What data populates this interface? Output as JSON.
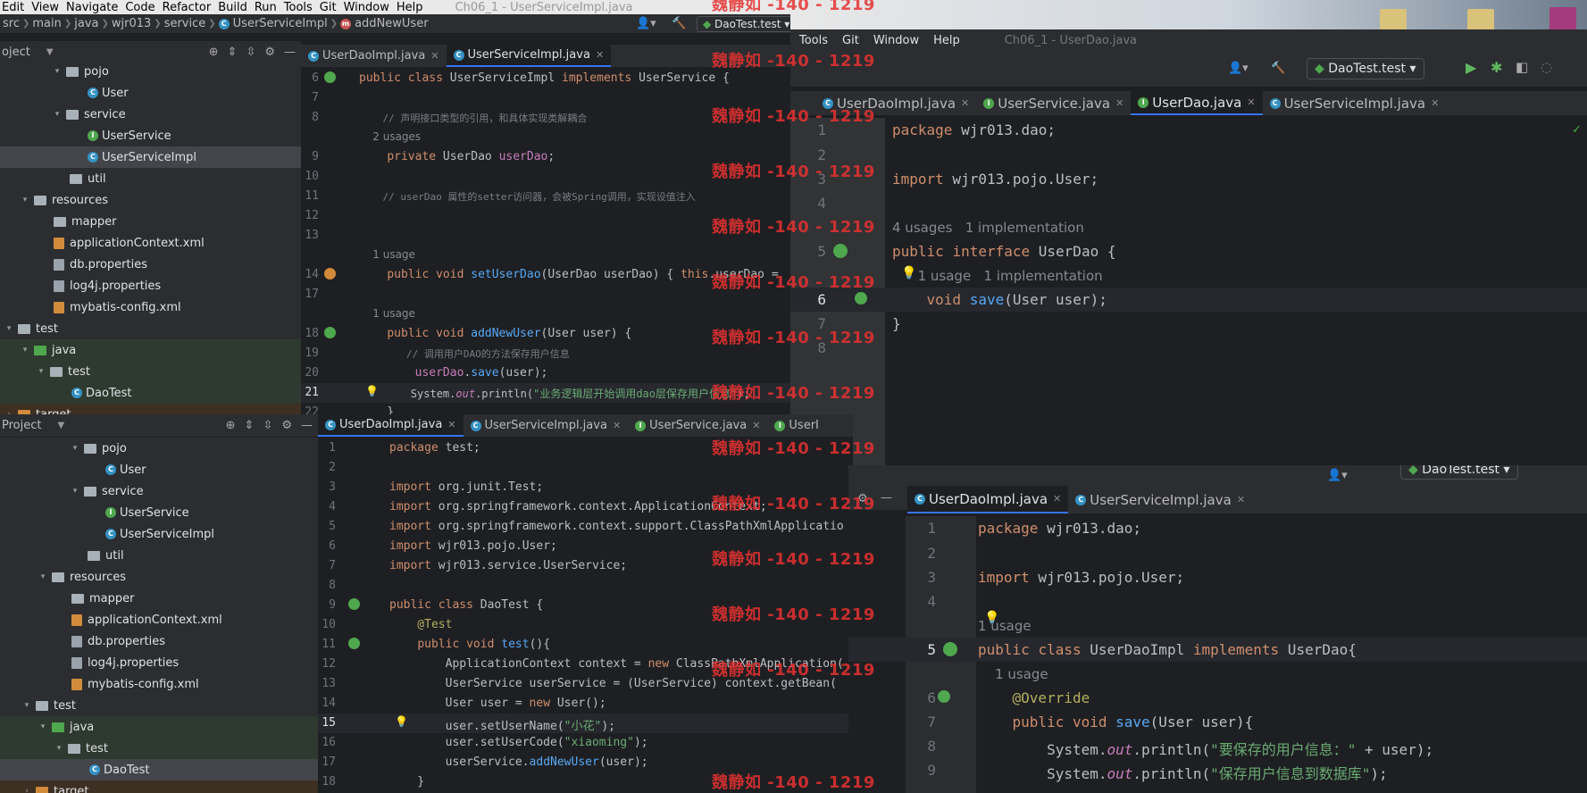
{
  "menu": [
    "Edit",
    "View",
    "Navigate",
    "Code",
    "Refactor",
    "Build",
    "Run",
    "Tools",
    "Git",
    "Window",
    "Help"
  ],
  "window_title_1": "Ch06_1 - UserServiceImpl.java",
  "breadcrumb": [
    "src",
    "main",
    "java",
    "wjr013",
    "service",
    "UserServiceImpl",
    "addNewUser"
  ],
  "run_config": "DaoTest.test",
  "topleft": {
    "tabs": [
      "UserDaoImpl.java",
      "UserServiceImpl.java"
    ],
    "project_label": "oject",
    "tree": [
      {
        "label": "pojo"
      },
      {
        "label": "User"
      },
      {
        "label": "service"
      },
      {
        "label": "UserService"
      },
      {
        "label": "UserServiceImpl"
      },
      {
        "label": "util"
      },
      {
        "label": "resources"
      },
      {
        "label": "mapper"
      },
      {
        "label": "applicationContext.xml"
      },
      {
        "label": "db.properties"
      },
      {
        "label": "log4j.properties"
      },
      {
        "label": "mybatis-config.xml"
      },
      {
        "label": "test"
      },
      {
        "label": "java"
      },
      {
        "label": "test"
      },
      {
        "label": "DaoTest"
      },
      {
        "label": "target"
      }
    ],
    "lines": [
      {
        "n": "6",
        "code": "public class UserServiceImpl implements UserService {"
      },
      {
        "n": "7",
        "code": ""
      },
      {
        "n": "8",
        "code": "    // 声明接口类型的引用，和具体实现类解耦合"
      },
      {
        "n": "",
        "code": "    2 usages"
      },
      {
        "n": "9",
        "code": "    private UserDao userDao;"
      },
      {
        "n": "10",
        "code": ""
      },
      {
        "n": "11",
        "code": "    // userDao 属性的setter访问器，会被Spring调用，实现设值注入"
      },
      {
        "n": "12",
        "code": ""
      },
      {
        "n": "13",
        "code": ""
      },
      {
        "n": "",
        "code": "    1 usage"
      },
      {
        "n": "14",
        "code": "    public void setUserDao(UserDao userDao) { this.userDao = "
      },
      {
        "n": "17",
        "code": ""
      },
      {
        "n": "",
        "code": "    1 usage"
      },
      {
        "n": "18",
        "code": "    public void addNewUser(User user) {"
      },
      {
        "n": "19",
        "code": "        // 调用用户DAO的方法保存用户信息"
      },
      {
        "n": "20",
        "code": "        userDao.save(user);"
      },
      {
        "n": "21",
        "code": "        System.out.println(\"业务逻辑层开始调用dao层保存用户信息\");"
      },
      {
        "n": "22",
        "code": "    }"
      }
    ]
  },
  "topright": {
    "menu": [
      "Tools",
      "Git",
      "Window",
      "Help"
    ],
    "title": "Ch06_1 - UserDao.java",
    "tabs": [
      "UserDaoImpl.java",
      "UserService.java",
      "UserDao.java",
      "UserServiceImpl.java"
    ],
    "lines": [
      {
        "n": "1",
        "code": "package wjr013.dao;"
      },
      {
        "n": "2",
        "code": ""
      },
      {
        "n": "3",
        "code": "import wjr013.pojo.User;"
      },
      {
        "n": "4",
        "code": ""
      },
      {
        "n": "",
        "code": "4 usages   1 implementation"
      },
      {
        "n": "5",
        "code": "public interface UserDao {"
      },
      {
        "n": "",
        "code": "      1 usage   1 implementation"
      },
      {
        "n": "6",
        "code": "    void save(User user);"
      },
      {
        "n": "7",
        "code": "}"
      },
      {
        "n": "8",
        "code": ""
      }
    ]
  },
  "bottomleft": {
    "project_label": "Project",
    "tabs": [
      "UserDaoImpl.java",
      "UserServiceImpl.java",
      "UserService.java",
      "UserI"
    ],
    "tree": [
      {
        "label": "pojo"
      },
      {
        "label": "User"
      },
      {
        "label": "service"
      },
      {
        "label": "UserService"
      },
      {
        "label": "UserServiceImpl"
      },
      {
        "label": "util"
      },
      {
        "label": "resources"
      },
      {
        "label": "mapper"
      },
      {
        "label": "applicationContext.xml"
      },
      {
        "label": "db.properties"
      },
      {
        "label": "log4j.properties"
      },
      {
        "label": "mybatis-config.xml"
      },
      {
        "label": "test"
      },
      {
        "label": "java"
      },
      {
        "label": "test"
      },
      {
        "label": "DaoTest"
      },
      {
        "label": "target"
      }
    ],
    "lines": [
      {
        "n": "1",
        "code": "package test;"
      },
      {
        "n": "2",
        "code": ""
      },
      {
        "n": "3",
        "code": "import org.junit.Test;"
      },
      {
        "n": "4",
        "code": "import org.springframework.context.ApplicationContext;"
      },
      {
        "n": "5",
        "code": "import org.springframework.context.support.ClassPathXmlApplicatio"
      },
      {
        "n": "6",
        "code": "import wjr013.pojo.User;"
      },
      {
        "n": "7",
        "code": "import wjr013.service.UserService;"
      },
      {
        "n": "8",
        "code": ""
      },
      {
        "n": "9",
        "code": "public class DaoTest {"
      },
      {
        "n": "10",
        "code": "    @Test"
      },
      {
        "n": "11",
        "code": "    public void test(){"
      },
      {
        "n": "12",
        "code": "        ApplicationContext context = new ClassPathXmlApplication("
      },
      {
        "n": "13",
        "code": "        UserService userService = (UserService) context.getBean("
      },
      {
        "n": "14",
        "code": "        User user = new User();"
      },
      {
        "n": "15",
        "code": "        user.setUserName(\"小花\");"
      },
      {
        "n": "16",
        "code": "        user.setUserCode(\"xiaoming\");"
      },
      {
        "n": "17",
        "code": "        userService.addNewUser(user);"
      },
      {
        "n": "18",
        "code": "    }"
      }
    ]
  },
  "bottomright": {
    "run_config": "DaoTest.test",
    "tabs": [
      "UserDaoImpl.java",
      "UserServiceImpl.java"
    ],
    "lines": [
      {
        "n": "1",
        "code": "package wjr013.dao;"
      },
      {
        "n": "2",
        "code": ""
      },
      {
        "n": "3",
        "code": "import wjr013.pojo.User;"
      },
      {
        "n": "4",
        "code": ""
      },
      {
        "n": "",
        "code": "1 usage"
      },
      {
        "n": "5",
        "code": "public class UserDaoImpl implements UserDao{"
      },
      {
        "n": "",
        "code": "    1 usage"
      },
      {
        "n": "6",
        "code": "    @Override"
      },
      {
        "n": "7",
        "code": "    public void save(User user){"
      },
      {
        "n": "8",
        "code": "        System.out.println(\"要保存的用户信息：\" + user);"
      },
      {
        "n": "9",
        "code": "        System.out.println(\"保存用户信息到数据库\");"
      }
    ]
  },
  "watermark": "魏静如 -140 - 1219",
  "colors": {
    "accent": "#3574f0",
    "watermark": "#e63131",
    "keyword": "#cf8e6d",
    "function": "#56a8f5",
    "field": "#c77dbb",
    "string": "#6aab73"
  }
}
